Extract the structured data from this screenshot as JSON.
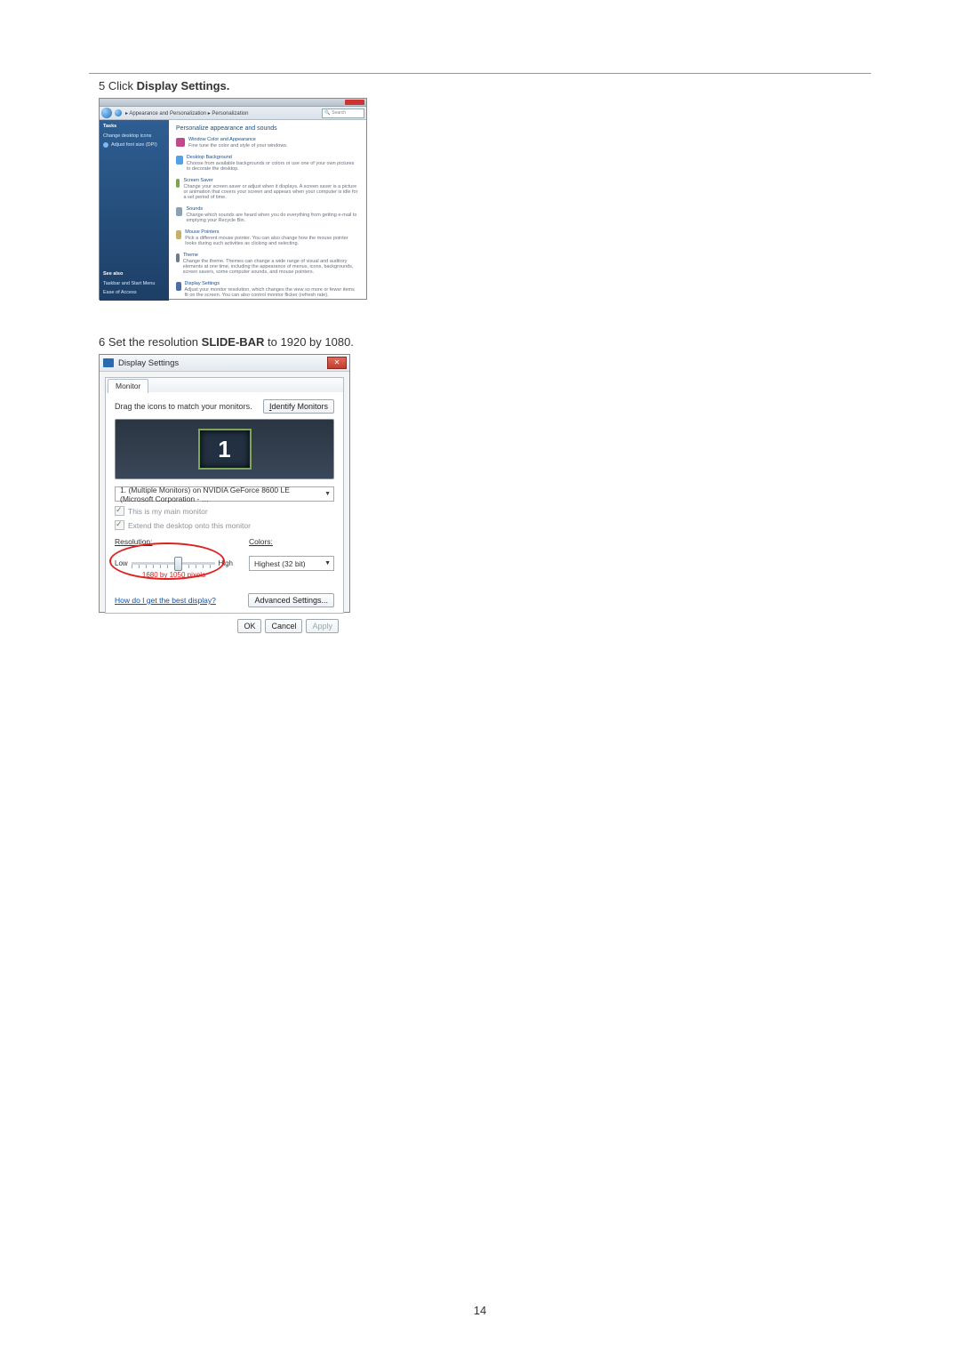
{
  "page_number": "14",
  "step5": {
    "num": "5",
    "pre": "Click ",
    "bold": "Display Settings."
  },
  "step6": {
    "num": "6",
    "pre": "Set the resolution ",
    "bold": "SLIDE-BAR",
    "post": " to 1920 by 1080."
  },
  "win1": {
    "breadcrumb": "▸ Appearance and Personalization ▸ Personalization",
    "search_placeholder": "Search",
    "sidebar": {
      "header": "Tasks",
      "items": [
        "Change desktop icons",
        "Adjust font size (DPI)"
      ],
      "bottom_header": "See also",
      "bottom_items": [
        "Taskbar and Start Menu",
        "Ease of Access"
      ]
    },
    "main_header": "Personalize appearance and sounds",
    "items": [
      {
        "title": "Window Color and Appearance",
        "desc": "Fine tune the color and style of your windows."
      },
      {
        "title": "Desktop Background",
        "desc": "Choose from available backgrounds or colors or use one of your own pictures to decorate the desktop."
      },
      {
        "title": "Screen Saver",
        "desc": "Change your screen saver or adjust when it displays. A screen saver is a picture or animation that covers your screen and appears when your computer is idle for a set period of time."
      },
      {
        "title": "Sounds",
        "desc": "Change which sounds are heard when you do everything from getting e-mail to emptying your Recycle Bin."
      },
      {
        "title": "Mouse Pointers",
        "desc": "Pick a different mouse pointer. You can also change how the mouse pointer looks during such activities as clicking and selecting."
      },
      {
        "title": "Theme",
        "desc": "Change the theme. Themes can change a wide range of visual and auditory elements at one time, including the appearance of menus, icons, backgrounds, screen savers, some computer sounds, and mouse pointers."
      },
      {
        "title": "Display Settings",
        "desc": "Adjust your monitor resolution, which changes the view so more or fewer items fit on the screen. You can also control monitor flicker (refresh rate)."
      }
    ]
  },
  "win2": {
    "title": "Display Settings",
    "tab": "Monitor",
    "drag_hint": "Drag the icons to match your monitors.",
    "identify_btn": "Identify Monitors",
    "monitor_number": "1",
    "monitor_select": "1. (Multiple Monitors) on NVIDIA GeForce 8600 LE (Microsoft Corporation - …",
    "chk_main": "This is my main monitor",
    "chk_extend": "Extend the desktop onto this monitor",
    "res_label": "Resolution:",
    "low": "Low",
    "high": "High",
    "res_text": "1680 by 1050 pixels",
    "colors_label": "Colors:",
    "colors_value": "Highest (32 bit)",
    "help_link": "How do I get the best display?",
    "adv_btn": "Advanced Settings...",
    "ok": "OK",
    "cancel": "Cancel",
    "apply": "Apply"
  }
}
